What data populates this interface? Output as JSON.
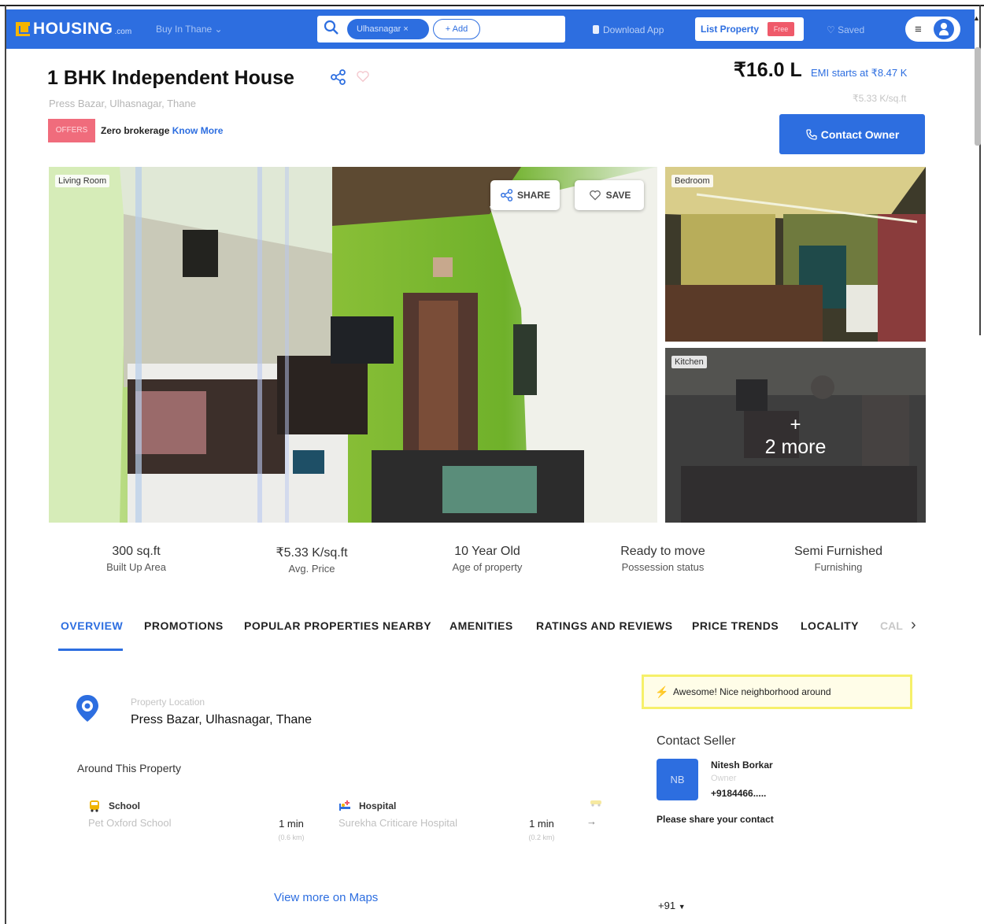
{
  "header": {
    "logo": "HOUSING",
    "logo_suffix": ".com",
    "buy_in": "Buy In Thane",
    "city_chip": "Ulhasnagar",
    "add_chip": "+ Add",
    "download_app": "Download App",
    "list_property": "List Property",
    "free_badge": "Free",
    "saved": "Saved"
  },
  "property": {
    "title": "1 BHK Independent House",
    "sublocation": "Press Bazar, Ulhasnagar, Thane",
    "offers_badge": "OFFERS",
    "offers_text": "Zero brokerage",
    "know_more": "Know More",
    "price": "₹16.0 L",
    "emi": "EMI starts at ₹8.47 K",
    "price_per_sqft": "₹5.33 K/sq.ft",
    "contact_owner": "Contact Owner"
  },
  "gallery": {
    "main_label": "Living Room",
    "share_label": "SHARE",
    "save_label": "SAVE",
    "bedroom_label": "Bedroom",
    "kitchen_label": "Kitchen",
    "more_plus": "+",
    "more_text": "2 more"
  },
  "stats": [
    {
      "value": "300 sq.ft",
      "label": "Built Up Area"
    },
    {
      "value": "₹5.33 K/sq.ft",
      "label": "Avg. Price"
    },
    {
      "value": "10 Year Old",
      "label": "Age of property"
    },
    {
      "value": "Ready to move",
      "label": "Possession status"
    },
    {
      "value": "Semi Furnished",
      "label": "Furnishing"
    }
  ],
  "tabs": [
    "OVERVIEW",
    "PROMOTIONS",
    "POPULAR PROPERTIES NEARBY",
    "AMENITIES",
    "RATINGS AND REVIEWS",
    "PRICE TRENDS",
    "LOCALITY",
    "CAL"
  ],
  "location": {
    "label": "Property Location",
    "value": "Press Bazar, Ulhasnagar, Thane",
    "around_title": "Around This Property",
    "places": [
      {
        "category": "School",
        "name": "Pet Oxford School",
        "time": "1 min",
        "distance": "(0.6 km)"
      },
      {
        "category": "Hospital",
        "name": "Surekha Criticare Hospital",
        "time": "1 min",
        "distance": "(0.2 km)"
      }
    ],
    "next_arrow": "→",
    "view_more": "View more on Maps"
  },
  "seller": {
    "neighborhood": "Awesome! Nice neighborhood around",
    "contact_title": "Contact Seller",
    "initials": "NB",
    "name": "Nitesh Borkar",
    "role": "Owner",
    "phone": "+9184466.....",
    "share_contact": "Please share your contact",
    "country_code": "+91"
  },
  "colors": {
    "brand_blue": "#2d6ee0",
    "offers_pink": "#f06c7c",
    "highlight_yellow": "#f6f06a"
  }
}
